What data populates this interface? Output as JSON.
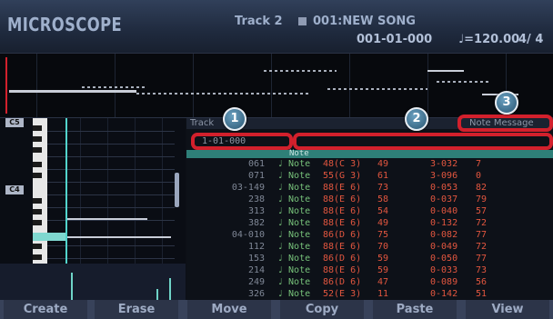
{
  "header": {
    "app_title": "MICROSCOPE",
    "track": "Track 2",
    "song": "001:NEW SONG",
    "position": "001-01-000",
    "tempo": "♩=120.00",
    "time_signature": "4/ 4"
  },
  "piano_roll": {
    "octave_c5": "C5",
    "octave_c4": "C4"
  },
  "event_list": {
    "header_track": "Track",
    "header_message": "Note Message",
    "locate_position": "1-01-000",
    "selected_text": "Note",
    "rows": [
      {
        "pos": "061",
        "type": "♩ Note",
        "note": "48(C 3)",
        "vel": "49",
        "gate": "3-032",
        "val": "7"
      },
      {
        "pos": "071",
        "type": "♩ Note",
        "note": "55(G 3)",
        "vel": "61",
        "gate": "3-096",
        "val": "0"
      },
      {
        "pos": "03-149",
        "type": "♩ Note",
        "note": "88(E 6)",
        "vel": "73",
        "gate": "0-053",
        "val": "82"
      },
      {
        "pos": "238",
        "type": "♩ Note",
        "note": "88(E 6)",
        "vel": "58",
        "gate": "0-037",
        "val": "79"
      },
      {
        "pos": "313",
        "type": "♩ Note",
        "note": "88(E 6)",
        "vel": "54",
        "gate": "0-040",
        "val": "57"
      },
      {
        "pos": "382",
        "type": "♩ Note",
        "note": "88(E 6)",
        "vel": "49",
        "gate": "0-132",
        "val": "72"
      },
      {
        "pos": "04-010",
        "type": "♩ Note",
        "note": "86(D 6)",
        "vel": "75",
        "gate": "0-082",
        "val": "77"
      },
      {
        "pos": "112",
        "type": "♩ Note",
        "note": "88(E 6)",
        "vel": "70",
        "gate": "0-049",
        "val": "72"
      },
      {
        "pos": "153",
        "type": "♩ Note",
        "note": "86(D 6)",
        "vel": "59",
        "gate": "0-050",
        "val": "77"
      },
      {
        "pos": "214",
        "type": "♩ Note",
        "note": "88(E 6)",
        "vel": "59",
        "gate": "0-033",
        "val": "73"
      },
      {
        "pos": "249",
        "type": "♩ Note",
        "note": "86(D 6)",
        "vel": "47",
        "gate": "0-089",
        "val": "56"
      },
      {
        "pos": "326",
        "type": "♩ Note",
        "note": "52(E 3)",
        "vel": "11",
        "gate": "0-142",
        "val": "51"
      }
    ]
  },
  "callouts": [
    "1",
    "2",
    "3"
  ],
  "footer": {
    "buttons": [
      "Create",
      "Erase",
      "Move",
      "Copy",
      "Paste",
      "View"
    ]
  }
}
